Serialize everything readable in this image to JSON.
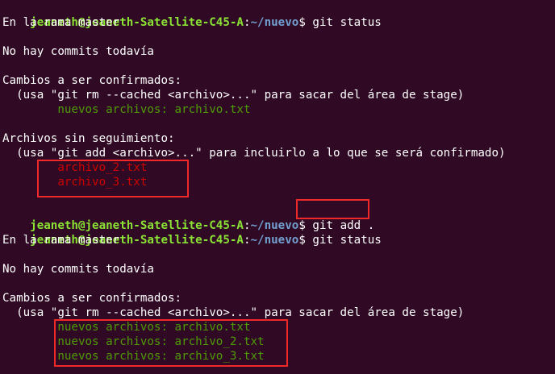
{
  "colors": {
    "background": "#300a24",
    "prompt_user": "#8ae234",
    "prompt_path": "#729fcf",
    "staged": "#4e9a06",
    "untracked": "#cc0000",
    "highlight_box": "#ef2929"
  },
  "prompt": {
    "user_host": "jeaneth@jeaneth-Satellite-C45-A",
    "colon": ":",
    "path": "~/nuevo",
    "dollar": "$ "
  },
  "block1": {
    "command": "git status",
    "branch": "En la rama master",
    "no_commits": "No hay commits todavía",
    "staged_header": "Cambios a ser confirmados:",
    "staged_hint": "  (usa \"git rm --cached <archivo>...\" para sacar del área de stage)",
    "staged_files": [
      "        nuevos archivos: archivo.txt"
    ],
    "untracked_header": "Archivos sin seguimiento:",
    "untracked_hint": "  (usa \"git add <archivo>...\" para incluirlo a lo que se será confirmado)",
    "untracked_files": [
      "        archivo_2.txt",
      "        archivo_3.txt"
    ]
  },
  "block2": {
    "command": "git add ."
  },
  "block3": {
    "command": "git status",
    "branch": "En la rama master",
    "no_commits": "No hay commits todavía",
    "staged_header": "Cambios a ser confirmados:",
    "staged_hint": "  (usa \"git rm --cached <archivo>...\" para sacar del área de stage)",
    "staged_files": [
      "        nuevos archivos: archivo.txt",
      "        nuevos archivos: archivo_2.txt",
      "        nuevos archivos: archivo_3.txt"
    ]
  }
}
